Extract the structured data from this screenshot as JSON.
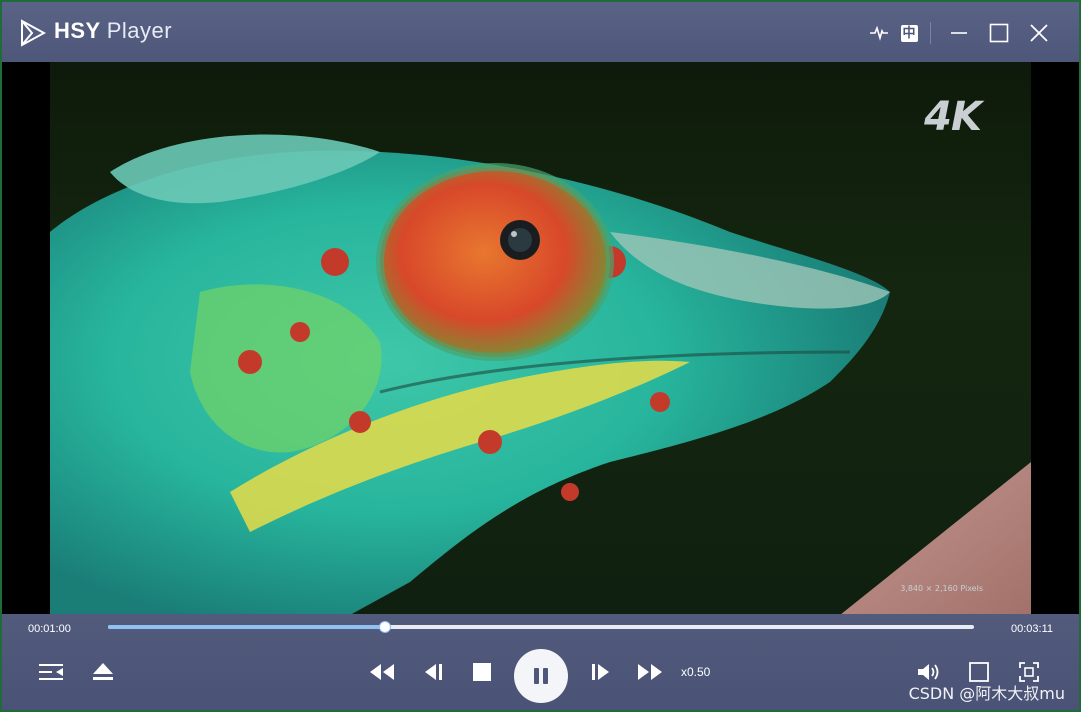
{
  "window": {
    "title_brand": "HSY",
    "title_rest": "Player",
    "colors": {
      "titlebar": "#535b7d",
      "accent": "#8fc1f2",
      "background": "#000000"
    }
  },
  "titlebar": {
    "icons": [
      "logo-icon",
      "waveform-icon",
      "language-icon",
      "minimize-icon",
      "maximize-icon",
      "close-icon"
    ],
    "language_label": "中"
  },
  "video": {
    "badge": "4K",
    "resolution_note": "3,840 × 2,160 Pixels"
  },
  "playback": {
    "current_time": "00:01:00",
    "total_time": "00:03:11",
    "progress": 0.32,
    "speed": "x0.50"
  },
  "controls": {
    "left": [
      "playlist-icon",
      "eject-icon"
    ],
    "center": [
      "rewind-icon",
      "previous-frame-icon",
      "stop-icon",
      "pause-icon",
      "next-frame-icon",
      "fast-forward-icon"
    ],
    "right": [
      "volume-icon",
      "window-mode-icon",
      "fullscreen-icon"
    ]
  },
  "watermark": "CSDN @阿木大叔mu"
}
